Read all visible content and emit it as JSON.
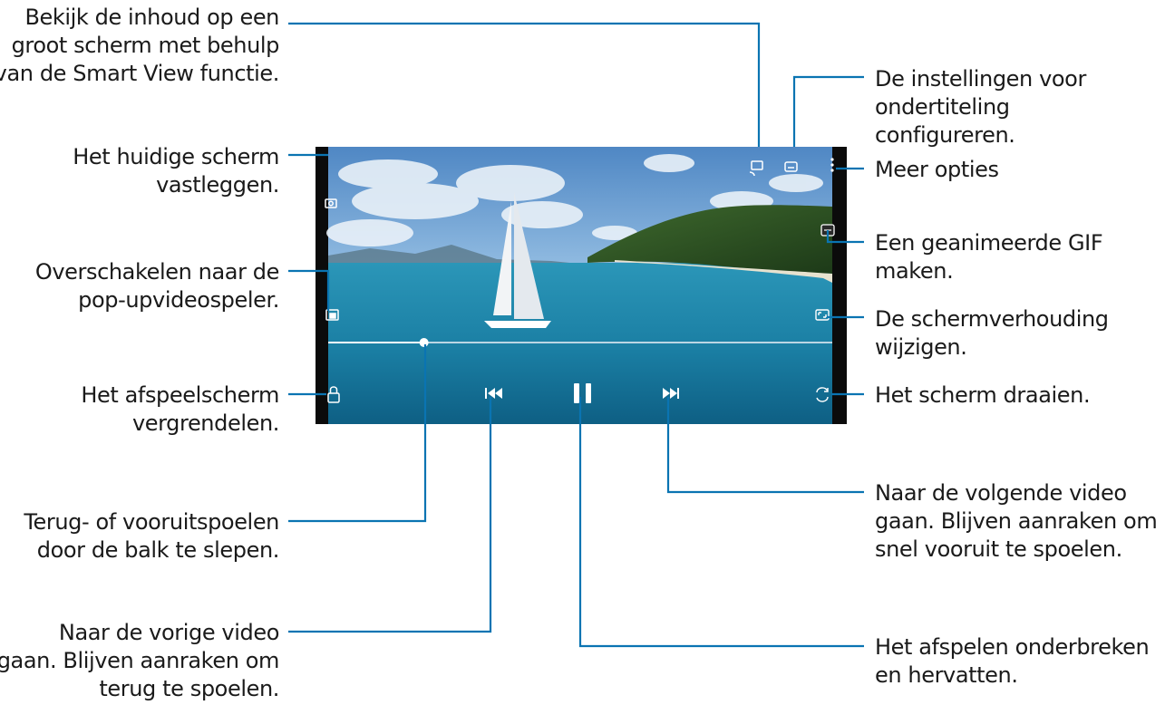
{
  "callouts": {
    "smart_view": [
      "Bekijk de inhoud op een",
      "groot scherm met behulp",
      "van de Smart View functie."
    ],
    "capture": [
      "Het huidige scherm",
      "vastleggen."
    ],
    "popup": [
      "Overschakelen naar de",
      "pop-upvideospeler."
    ],
    "lock": [
      "Het afspeelscherm",
      "vergrendelen."
    ],
    "seek": [
      "Terug- of vooruitspoelen",
      "door de balk te slepen."
    ],
    "previous": [
      "Naar de vorige video",
      "gaan. Blijven aanraken om",
      "terug te spoelen."
    ],
    "subtitles": [
      "De instellingen voor",
      "ondertiteling",
      "configureren."
    ],
    "more": [
      "Meer opties"
    ],
    "gif": [
      "Een geanimeerde GIF",
      "maken."
    ],
    "ratio": [
      "De schermverhouding",
      "wijzigen."
    ],
    "rotate": [
      "Het scherm draaien."
    ],
    "next": [
      "Naar de volgende video",
      "gaan. Blijven aanraken om",
      "snel vooruit te spoelen."
    ],
    "pause": [
      "Het afspelen onderbreken",
      "en hervatten."
    ]
  },
  "player": {
    "progress": 0.19,
    "icons": [
      "cast-icon",
      "subtitles-icon",
      "more-options-icon",
      "capture-icon",
      "gif-icon",
      "popup-player-icon",
      "aspect-ratio-icon",
      "lock-icon",
      "rewind-icon",
      "pause-icon",
      "fast-forward-icon",
      "rotate-icon"
    ]
  },
  "colors": {
    "leader_line": "#0a74b2",
    "text": "#1a1a1a"
  }
}
